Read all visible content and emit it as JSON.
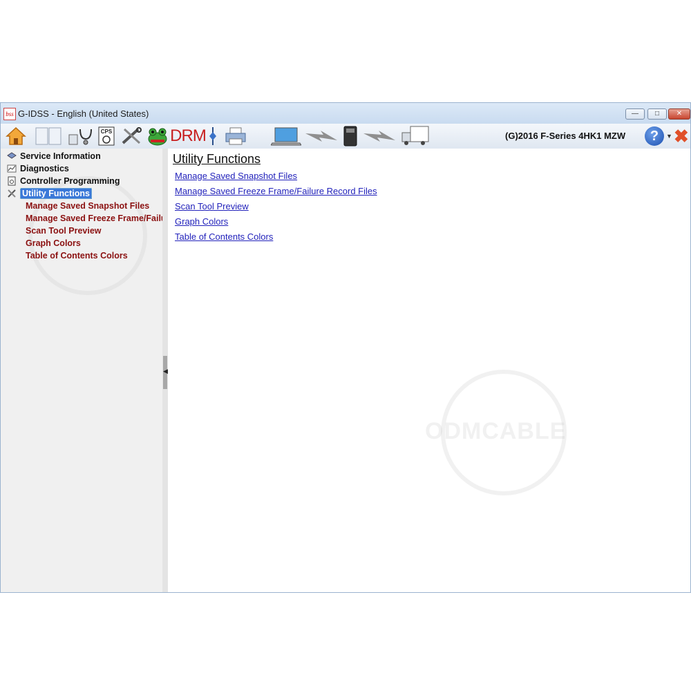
{
  "window": {
    "title": "G-IDSS - English (United States)",
    "app_icon_text": "bss"
  },
  "toolbar": {
    "buttons": [
      {
        "name": "home",
        "icon": "home-icon"
      },
      {
        "name": "book",
        "icon": "book-icon"
      },
      {
        "name": "diagnostics",
        "icon": "stethoscope-icon"
      },
      {
        "name": "cps",
        "icon": "cps-icon",
        "label": "CPS"
      },
      {
        "name": "utility",
        "icon": "tools-icon"
      },
      {
        "name": "frog",
        "icon": "frog-icon"
      },
      {
        "name": "drm",
        "label": "DRM"
      },
      {
        "name": "connector",
        "icon": "connector-icon"
      },
      {
        "name": "print",
        "icon": "printer-icon"
      },
      {
        "name": "laptop",
        "icon": "laptop-icon"
      },
      {
        "name": "link1",
        "icon": "lightning-icon"
      },
      {
        "name": "device",
        "icon": "scan-tool-icon"
      },
      {
        "name": "link2",
        "icon": "lightning-icon"
      },
      {
        "name": "truck",
        "icon": "truck-icon"
      }
    ],
    "vehicle": "(G)2016 F-Series 4HK1 MZW",
    "help_label": "?"
  },
  "sidebar": {
    "items": [
      {
        "label": "Service Information",
        "icon": "layers-icon"
      },
      {
        "label": "Diagnostics",
        "icon": "chart-icon"
      },
      {
        "label": "Controller Programming",
        "icon": "document-icon"
      },
      {
        "label": "Utility Functions",
        "icon": "tools-icon",
        "selected": true
      }
    ],
    "subitems": [
      "Manage Saved Snapshot Files",
      "Manage Saved Freeze Frame/Failure Record Files",
      "Scan Tool Preview",
      "Graph Colors",
      "Table of Contents Colors"
    ]
  },
  "content": {
    "heading": "Utility Functions",
    "links": [
      "Manage Saved Snapshot Files",
      "Manage Saved Freeze Frame/Failure Record Files",
      "Scan Tool Preview",
      "Graph Colors",
      "Table of Contents Colors"
    ]
  },
  "watermark": "ODMCABLE"
}
